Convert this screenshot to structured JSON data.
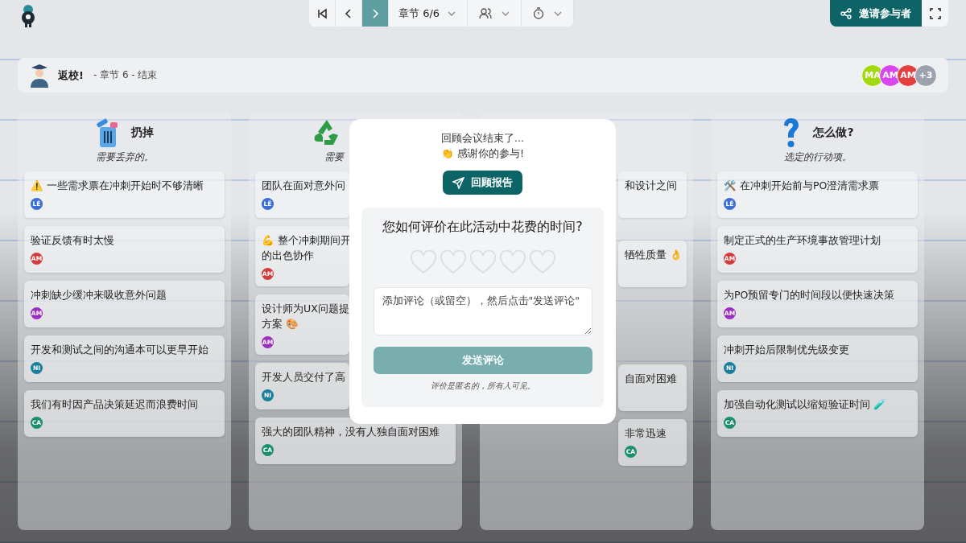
{
  "toolbar": {
    "nav": [
      {
        "kind": "first",
        "selected": false
      },
      {
        "kind": "prev",
        "selected": false
      },
      {
        "kind": "next",
        "selected": true
      }
    ],
    "chapter": "章节 6/6",
    "invite": "邀请参与者"
  },
  "header": {
    "title": "返校!",
    "subtitle": "- 章节 6 - 结束",
    "participants": [
      {
        "initials": "MA",
        "color": "#a3d911"
      },
      {
        "initials": "AM",
        "color": "#d946ef"
      },
      {
        "initials": "AM",
        "color": "#e53e3e"
      }
    ],
    "more": "+3"
  },
  "columns": [
    {
      "kind": "trash",
      "title": "扔掉",
      "subtitle": "需要丢弃的。",
      "cards": [
        {
          "lines": [
            "⚠️ 一些需求票在冲刺开始时不够清晰"
          ],
          "author": {
            "initials": "LÉ",
            "color": "#3b6fd4"
          }
        },
        {
          "lines": [
            "验证反馈有时太慢"
          ],
          "author": {
            "initials": "AM",
            "color": "#d43b3b"
          }
        },
        {
          "lines": [
            "冲刺缺少缓冲来吸收意外问题"
          ],
          "author": {
            "initials": "AM",
            "color": "#9b2fc0"
          }
        },
        {
          "lines": [
            "开发和测试之间的沟通本可以更早开始"
          ],
          "author": {
            "initials": "NI",
            "color": "#1a7f9e"
          }
        },
        {
          "lines": [
            "我们有时因产品决策延迟而浪费时间"
          ],
          "author": {
            "initials": "CA",
            "color": "#1a8f6a"
          }
        }
      ]
    },
    {
      "kind": "recycle",
      "subtitle": "需要",
      "cards": [
        {
          "lines": [
            "团队在面对意外问"
          ],
          "author": {
            "initials": "LÉ",
            "color": "#3b6fd4"
          }
        },
        {
          "lines": [
            "💪 整个冲刺期间开",
            "的出色协作"
          ],
          "author": {
            "initials": "AM",
            "color": "#d43b3b"
          }
        },
        {
          "lines": [
            "设计师为UX问题提",
            "方案 🎨"
          ],
          "author": {
            "initials": "AM",
            "color": "#9b2fc0"
          }
        },
        {
          "lines": [
            "开发人员交付了高"
          ],
          "author": {
            "initials": "NI",
            "color": "#1a7f9e"
          }
        },
        {
          "lines": [
            "强大的团队精神，没有人独自面对困难"
          ],
          "author": {
            "initials": "CA",
            "color": "#1a8f6a"
          }
        }
      ]
    },
    {
      "kind": "hidden",
      "cards": [
        {
          "lines": [
            "和设计之间"
          ]
        },
        {
          "lines": [
            "牺牲质量 👌"
          ]
        },
        {
          "lines": [
            "自面对困难"
          ]
        },
        {
          "lines": [
            "非常迅速"
          ],
          "author": {
            "initials": "CA",
            "color": "#1a8f6a"
          }
        }
      ]
    },
    {
      "kind": "question",
      "title": "怎么做?",
      "subtitle": "选定的行动项。",
      "cards": [
        {
          "lines": [
            "🛠️ 在冲刺开始前与PO澄清需求票"
          ],
          "author": {
            "initials": "LÉ",
            "color": "#3b6fd4"
          }
        },
        {
          "lines": [
            "制定正式的生产环境事故管理计划"
          ],
          "author": {
            "initials": "AM",
            "color": "#d43b3b"
          }
        },
        {
          "lines": [
            "为PO预留专门的时间段以便快速决策"
          ],
          "author": {
            "initials": "AM",
            "color": "#9b2fc0"
          }
        },
        {
          "lines": [
            "冲刺开始后限制优先级变更"
          ],
          "author": {
            "initials": "NI",
            "color": "#1a7f9e"
          }
        },
        {
          "lines": [
            "加强自动化测试以缩短验证时间 🧪"
          ],
          "author": {
            "initials": "CA",
            "color": "#1a8f6a"
          }
        }
      ]
    }
  ],
  "modal": {
    "line1": "回顾会议结束了...",
    "line2": "👏 感谢你的参与!",
    "report": "回顾报告",
    "rating": {
      "question": "您如何评价在此活动中花费的时间?",
      "stars": 0,
      "placeholder": "添加评论（或留空），然后点击\"发送评论\"",
      "send": "发送评论",
      "send_disabled": true,
      "note": "评价是匿名的，所有人可见。"
    }
  }
}
